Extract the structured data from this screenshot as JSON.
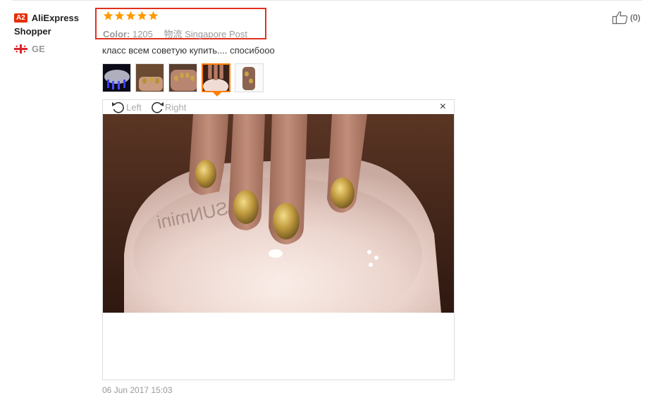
{
  "user": {
    "level_badge": "A2",
    "name": "AliExpress Shopper",
    "country_code": "GE",
    "flag_icon": "georgia-flag-icon"
  },
  "rating": {
    "stars": 5,
    "max": 5,
    "color": "#ff9a00"
  },
  "meta": {
    "color_label": "Color:",
    "color_value": "1205",
    "shipping_label": "物流",
    "shipping_value": "Singapore Post"
  },
  "helpful": {
    "icon": "thumbs-up-icon",
    "count": "(0)"
  },
  "review": {
    "text": "класс всем советую купить.... спосибооо"
  },
  "thumbnails": [
    {
      "name": "thumbnail-1",
      "active": false
    },
    {
      "name": "thumbnail-2",
      "active": false
    },
    {
      "name": "thumbnail-3",
      "active": false
    },
    {
      "name": "thumbnail-4",
      "active": true
    },
    {
      "name": "thumbnail-5",
      "active": false
    }
  ],
  "viewer": {
    "rotate_left": "Left",
    "rotate_right": "Right",
    "close": "×"
  },
  "date": "06 Jun 2017 15:03",
  "colors": {
    "highlight_box": "#e0311f",
    "active_thumb": "#ff7e00",
    "badge": "#e62e04"
  }
}
